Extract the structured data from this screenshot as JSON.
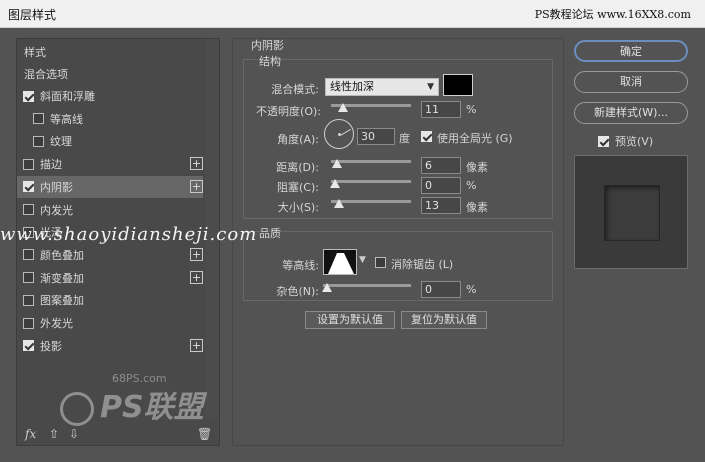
{
  "window": {
    "title": "图层样式",
    "watermark_top": "PS教程论坛 www.16XX8.com"
  },
  "left": {
    "header": "样式",
    "blend_options": "混合选项",
    "items": [
      {
        "label": "斜面和浮雕",
        "checked": true,
        "plus": false,
        "indent": false
      },
      {
        "label": "等高线",
        "checked": false,
        "plus": false,
        "indent": true
      },
      {
        "label": "纹理",
        "checked": false,
        "plus": false,
        "indent": true
      },
      {
        "label": "描边",
        "checked": false,
        "plus": true,
        "indent": false
      },
      {
        "label": "内阴影",
        "checked": true,
        "plus": true,
        "indent": false,
        "selected": true
      },
      {
        "label": "内发光",
        "checked": false,
        "plus": false,
        "indent": false
      },
      {
        "label": "光泽",
        "checked": false,
        "plus": false,
        "indent": false
      },
      {
        "label": "颜色叠加",
        "checked": false,
        "plus": true,
        "indent": false
      },
      {
        "label": "渐变叠加",
        "checked": false,
        "plus": true,
        "indent": false
      },
      {
        "label": "图案叠加",
        "checked": false,
        "plus": false,
        "indent": false
      },
      {
        "label": "外发光",
        "checked": false,
        "plus": false,
        "indent": false
      },
      {
        "label": "投影",
        "checked": true,
        "plus": true,
        "indent": false
      }
    ],
    "footer": {
      "fx": "fx",
      "up": "⇧",
      "down": "⇩",
      "trash": "🗑"
    }
  },
  "inner_shadow": {
    "title": "内阴影",
    "structure_title": "结构",
    "blend_mode_label": "混合模式:",
    "blend_mode_value": "线性加深",
    "color": "#000000",
    "opacity_label": "不透明度(O):",
    "opacity_value": "11",
    "opacity_unit": "%",
    "angle_label": "角度(A):",
    "angle_value": "30",
    "angle_unit": "度",
    "global_light_label": "使用全局光 (G)",
    "global_light_checked": true,
    "distance_label": "距离(D):",
    "distance_value": "6",
    "distance_unit": "像素",
    "choke_label": "阻塞(C):",
    "choke_value": "0",
    "choke_unit": "%",
    "size_label": "大小(S):",
    "size_value": "13",
    "size_unit": "像素",
    "quality_title": "品质",
    "contour_label": "等高线:",
    "antialias_label": "消除锯齿 (L)",
    "noise_label": "杂色(N):",
    "noise_value": "0",
    "noise_unit": "%",
    "set_default": "设置为默认值",
    "reset_default": "复位为默认值"
  },
  "right": {
    "ok": "确定",
    "cancel": "取消",
    "new_style": "新建样式(W)...",
    "preview_label": "预览(V)",
    "preview_checked": true
  },
  "watermarks": {
    "line": "www.shaoyidiansheji.com",
    "ps68": "68PS.com",
    "logo": "PS联盟"
  },
  "accent": "#6c8ebf"
}
